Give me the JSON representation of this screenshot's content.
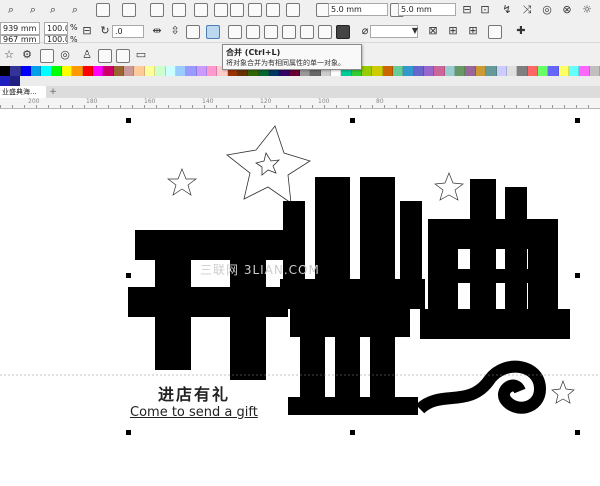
{
  "toolbar": {
    "x_value": "939 mm",
    "y_value": "967 mm",
    "scale_x": "100.0",
    "scale_y": "100.0",
    "pct1": "%",
    "pct2": "%",
    "rotation": ".0",
    "outline1": "5.0 mm",
    "outline2": "5.0 mm"
  },
  "tooltip": {
    "title": "合并 (Ctrl+L)",
    "desc": "将对象合并为有相同属性的单一对象。"
  },
  "palette": [
    "#000000",
    "#333399",
    "#0000ff",
    "#00a0e9",
    "#00ffff",
    "#00ff00",
    "#ffff00",
    "#ff9900",
    "#ff0000",
    "#ff00ff",
    "#cc0066",
    "#996633",
    "#cc9999",
    "#ffcc99",
    "#ffff99",
    "#ccffcc",
    "#ccffff",
    "#99ccff",
    "#9999ff",
    "#cc99ff",
    "#ff99cc",
    "#ffcccc",
    "#993300",
    "#663300",
    "#336600",
    "#006633",
    "#003366",
    "#330066",
    "#660033",
    "#999999",
    "#666666",
    "#cccccc",
    "#ffffff",
    "#00cc99",
    "#33cc33",
    "#99cc00",
    "#cccc00",
    "#cc6600",
    "#66cc99",
    "#3399cc",
    "#6666cc",
    "#9966cc",
    "#cc6699",
    "#99cccc",
    "#669966",
    "#996699",
    "#cc9933",
    "#669999",
    "#ccccff",
    "#e0e0e0",
    "#7f7f7f",
    "#ff6666",
    "#66ff66",
    "#6666ff",
    "#ffff66",
    "#66ffff",
    "#ff66ff",
    "#bfbfbf"
  ],
  "document": {
    "tab": "业盛典海..."
  },
  "ruler": {
    "labels": [
      "200",
      "180",
      "160",
      "140",
      "120",
      "100",
      "80"
    ]
  },
  "canvas": {
    "watermark": "三联网 3LIAN.COM",
    "char1": "开",
    "char2": "业",
    "char3": "盛",
    "char4": "典",
    "line1": "进店有礼",
    "line2": "Come to send a gift"
  }
}
